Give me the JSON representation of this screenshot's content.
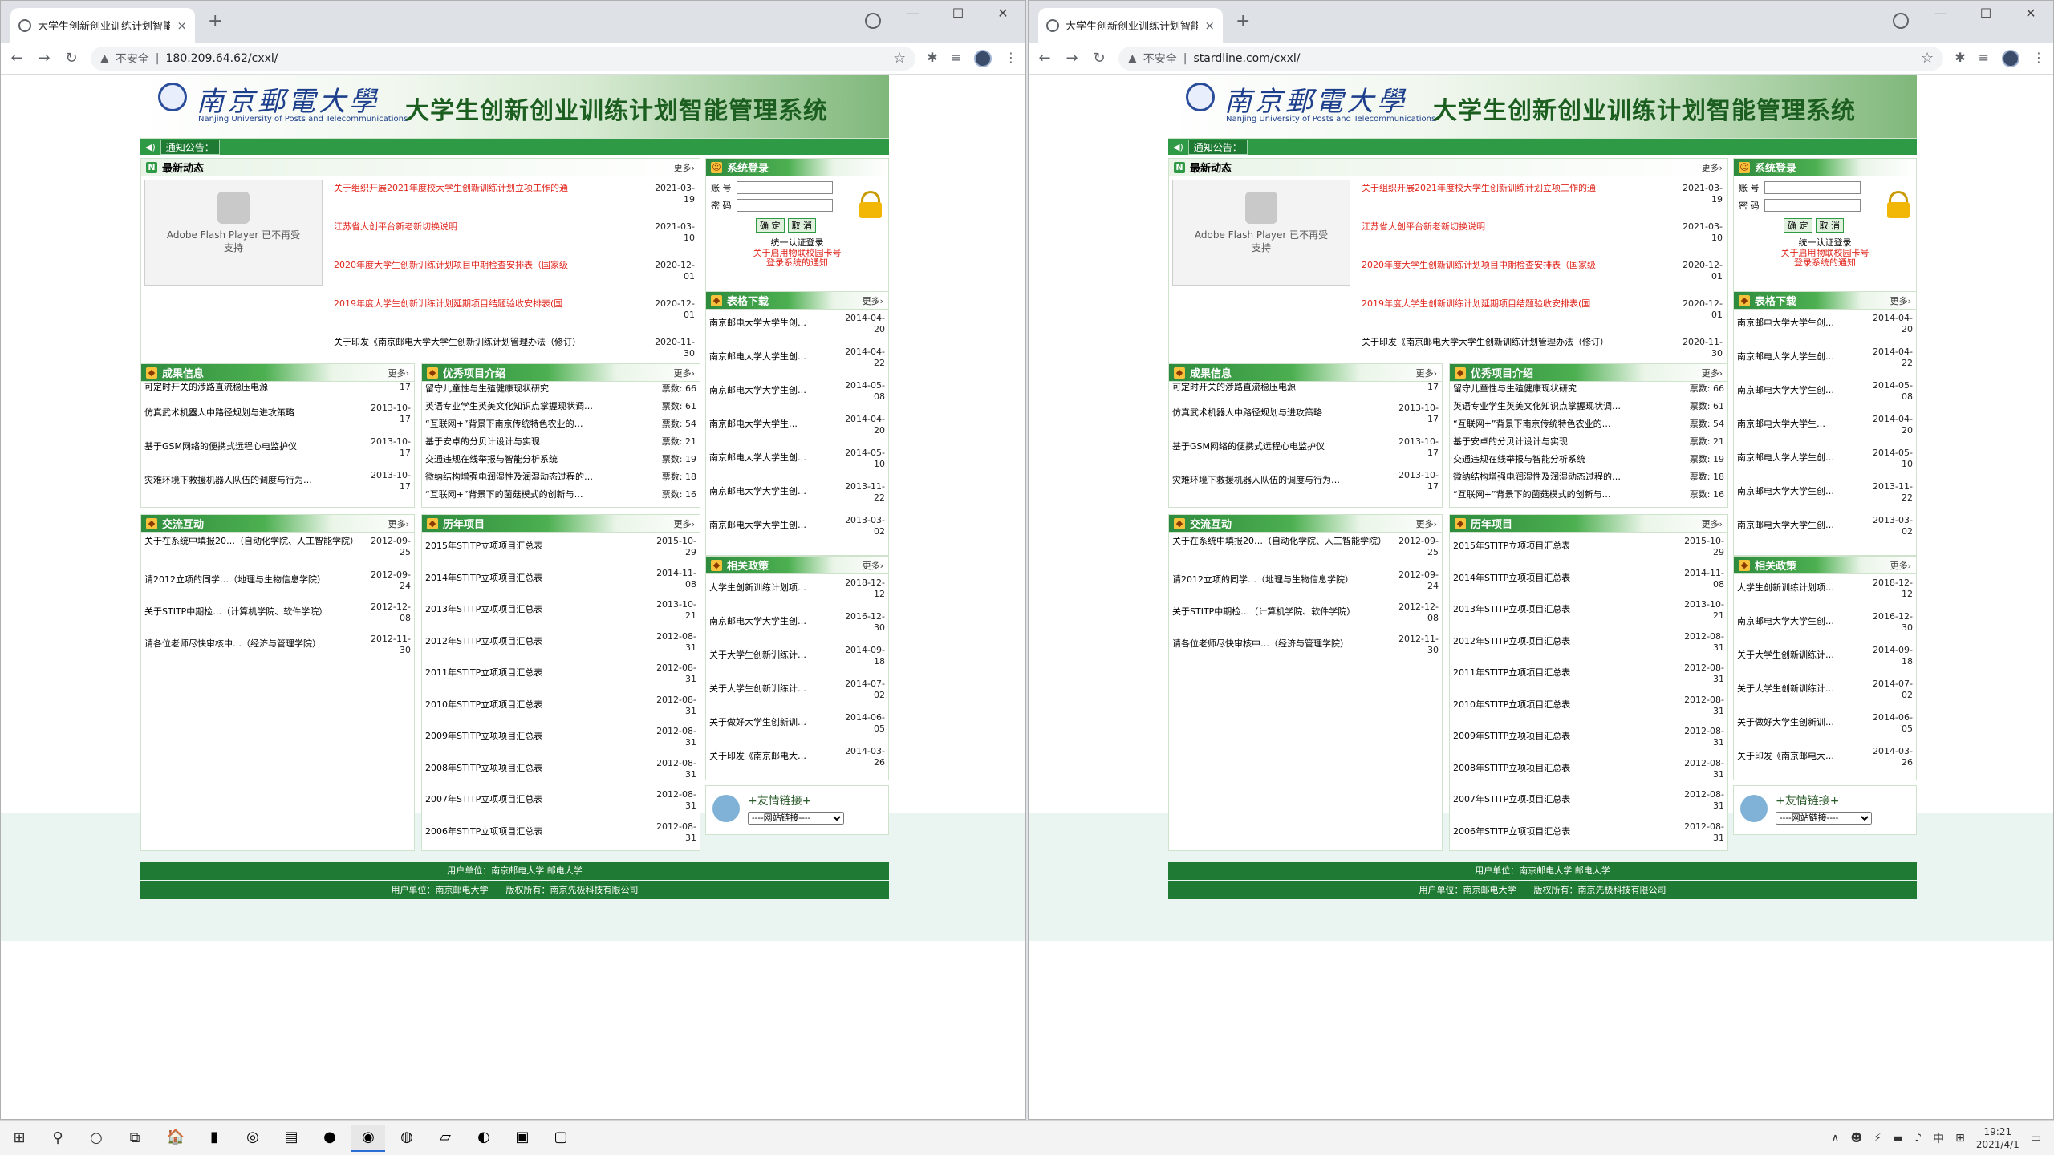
{
  "browser": {
    "tab_title": "大学生创新创业训练计划智能管",
    "tab_close": "×",
    "new_tab": "+",
    "win_min": "—",
    "win_max": "☐",
    "win_close": "✕",
    "security": "不安全",
    "warn_icon": "▲"
  },
  "windows": [
    {
      "url": "180.209.64.62/cxxl/"
    },
    {
      "url": "stardline.com/cxxl/"
    }
  ],
  "site": {
    "uni_cn": "南京郵電大學",
    "uni_en": "Nanjing University of Posts and Telecommunications",
    "system_title": "大学生创新创业训练计划智能管理系统",
    "notice_label": "通知公告：",
    "more": "更多›",
    "news": {
      "title": "最新动态",
      "flash_line1": "Adobe Flash Player 已不再受",
      "flash_line2": "支持",
      "items": [
        {
          "t": "关于组织开展2021年度校大学生创新训练计划立项工作的通",
          "d": "2021-03-\n19",
          "red": true
        },
        {
          "t": "江苏省大创平台新老新切换说明",
          "d": "2021-03-\n10",
          "red": true
        },
        {
          "t": "2020年度大学生创新训练计划项目中期检查安排表（国家级",
          "d": "2020-12-\n01",
          "red": true
        },
        {
          "t": "2019年度大学生创新训练计划延期项目结题验收安排表(国",
          "d": "2020-12-\n01",
          "red": true
        },
        {
          "t": "关于印发《南京邮电大学大学生创新训练计划管理办法（修订）",
          "d": "2020-11-\n30",
          "red": false
        }
      ]
    },
    "login": {
      "title": "系统登录",
      "account_label": "账 号",
      "password_label": "密 码",
      "ok": "确 定",
      "cancel": "取 消",
      "sso": "统一认证登录",
      "notice1": "关于启用物联校园卡号",
      "notice2": "登录系统的通知"
    },
    "forms": {
      "title": "表格下载",
      "items": [
        {
          "t": "南京邮电大学大学生创…",
          "d": "2014-04-\n20"
        },
        {
          "t": "南京邮电大学大学生创…",
          "d": "2014-04-\n22"
        },
        {
          "t": "南京邮电大学大学生创…",
          "d": "2014-05-\n08"
        },
        {
          "t": "南京邮电大学大学生…",
          "d": "2014-04-\n20"
        },
        {
          "t": "南京邮电大学大学生创…",
          "d": "2014-05-\n10"
        },
        {
          "t": "南京邮电大学大学生创…",
          "d": "2013-11-\n22"
        },
        {
          "t": "南京邮电大学大学生创…",
          "d": "2013-03-\n02"
        }
      ]
    },
    "results": {
      "title": "成果信息",
      "items": [
        {
          "t": "可定时开关的涉路直流稳压电源",
          "d": "17"
        },
        {
          "t": "仿真武术机器人中路径规划与进攻策略",
          "d": "2013-10-\n17"
        },
        {
          "t": "基于GSM网络的便携式远程心电监护仪",
          "d": "2013-10-\n17"
        },
        {
          "t": "灾难环境下救援机器人队伍的调度与行为…",
          "d": "2013-10-\n17"
        }
      ]
    },
    "projects": {
      "title": "优秀项目介绍",
      "items": [
        {
          "t": "留守儿童性与生殖健康现状研究",
          "v": "票数: 66"
        },
        {
          "t": "英语专业学生英美文化知识点掌握现状调…",
          "v": "票数: 61"
        },
        {
          "t": "“互联网+”背景下南京传统特色农业的…",
          "v": "票数: 54"
        },
        {
          "t": "基于安卓的分贝计设计与实现",
          "v": "票数: 21"
        },
        {
          "t": "交通违规在线举报与智能分析系统",
          "v": "票数: 19"
        },
        {
          "t": "微纳结构增强电润湿性及润湿动态过程的…",
          "v": "票数: 18"
        },
        {
          "t": "“互联网+”背景下的菌菇模式的创新与…",
          "v": "票数: 16"
        }
      ]
    },
    "exchange": {
      "title": "交流互动",
      "items": [
        {
          "t": "关于在系统中填报20…（自动化学院、人工智能学院）",
          "d": "2012-09-\n25"
        },
        {
          "t": "请2012立项的同学…（地理与生物信息学院）",
          "d": "2012-09-\n24"
        },
        {
          "t": "关于STITP中期检…（计算机学院、软件学院）",
          "d": "2012-12-\n08"
        },
        {
          "t": "请各位老师尽快审核中…（经济与管理学院）",
          "d": "2012-11-\n30"
        }
      ]
    },
    "history": {
      "title": "历年项目",
      "items": [
        {
          "t": "2015年STITP立项项目汇总表",
          "d": "2015-10-\n29"
        },
        {
          "t": "2014年STITP立项项目汇总表",
          "d": "2014-11-\n08"
        },
        {
          "t": "2013年STITP立项项目汇总表",
          "d": "2013-10-\n21"
        },
        {
          "t": "2012年STITP立项项目汇总表",
          "d": "2012-08-\n31"
        },
        {
          "t": "2011年STITP立项项目汇总表",
          "d": "2012-08-\n31"
        },
        {
          "t": "2010年STITP立项项目汇总表",
          "d": "2012-08-\n31"
        },
        {
          "t": "2009年STITP立项项目汇总表",
          "d": "2012-08-\n31"
        },
        {
          "t": "2008年STITP立项项目汇总表",
          "d": "2012-08-\n31"
        },
        {
          "t": "2007年STITP立项项目汇总表",
          "d": "2012-08-\n31"
        },
        {
          "t": "2006年STITP立项项目汇总表",
          "d": "2012-08-\n31"
        }
      ]
    },
    "policy": {
      "title": "相关政策",
      "items": [
        {
          "t": "大学生创新训练计划项…",
          "d": "2018-12-\n12"
        },
        {
          "t": "南京邮电大学大学生创…",
          "d": "2016-12-\n30"
        },
        {
          "t": "关于大学生创新训练计…",
          "d": "2014-09-\n18"
        },
        {
          "t": "关于大学生创新训练计…",
          "d": "2014-07-\n02"
        },
        {
          "t": "关于做好大学生创新训…",
          "d": "2014-06-\n05"
        },
        {
          "t": "关于印发《南京邮电大…",
          "d": "2014-03-\n26"
        }
      ]
    },
    "links": {
      "title": "+友情链接+",
      "select": "----网站链接----"
    },
    "footer1": "用户单位：南京邮电大学 邮电大学",
    "footer2": "用户单位：南京邮电大学　　版权所有：南京先极科技有限公司"
  },
  "taskbar": {
    "start": "⊞",
    "search": "⚲",
    "cortana": "○",
    "taskview": "⧉",
    "apps": [
      "🏠",
      "▮",
      "◎",
      "▤",
      "●",
      "◉",
      "◍",
      "▱",
      "◐",
      "▣",
      "▢"
    ],
    "tray": [
      "∧",
      "☻",
      "⚡",
      "▬",
      "♪",
      "中",
      "⊞"
    ],
    "time": "19:21",
    "date": "2021/4/1",
    "notify": "▭"
  }
}
